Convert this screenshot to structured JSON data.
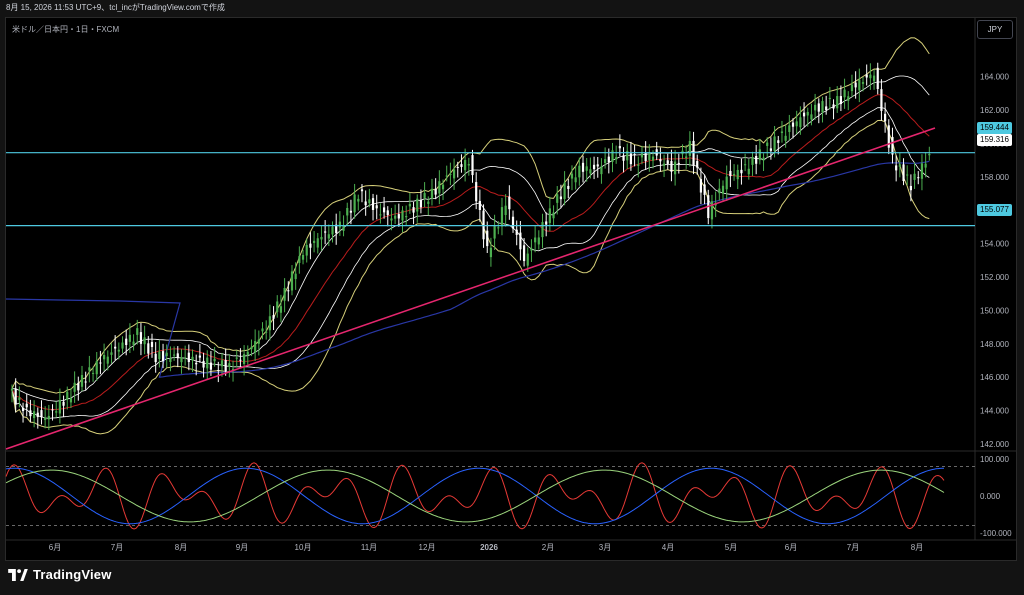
{
  "header": {
    "caption": "8月 15, 2026 11:53 UTC+9、tcl_incがTradingView.comで作成"
  },
  "symbol": {
    "label": "米ドル／日本円・1日・FXCM"
  },
  "currency_button": {
    "label": "JPY"
  },
  "brand": {
    "name": "TradingView",
    "icon": "tradingview-logo-icon"
  },
  "colors": {
    "background": "#000000",
    "candle_up": "#4caf50",
    "candle_down": "#ffffff",
    "trendline": "#e5266e",
    "horizontal_line": "#4ec9e0",
    "sma_long": "#2937a5",
    "bollinger_outer": "#d6cf7a",
    "bollinger_inner": "#ffffff",
    "bollinger_mid": "#b71c1c",
    "osc_red": "#e53935",
    "osc_blue": "#2962ff",
    "osc_green": "#9bd47d"
  },
  "price_tags": {
    "upper_level": "159.444",
    "last_price": "159.316",
    "lower_level": "155.077"
  },
  "chart_data": {
    "type": "line",
    "title": "米ドル／日本円・1日・FXCM",
    "ylim": [
      141.0,
      166.0
    ],
    "y_ticks": [
      "164.000",
      "162.000",
      "160.000",
      "158.000",
      "156.000",
      "154.000",
      "152.000",
      "150.000",
      "148.000",
      "146.000",
      "144.000",
      "142.000"
    ],
    "x_ticks": [
      "6月",
      "7月",
      "8月",
      "9月",
      "10月",
      "11月",
      "12月",
      "2026",
      "2月",
      "3月",
      "4月",
      "5月",
      "6月",
      "7月",
      "8月"
    ],
    "series": [
      {
        "type": "close",
        "values": [
          145.2,
          144.0,
          143.5,
          144.6,
          145.8,
          147.0,
          147.8,
          148.6,
          147.2,
          147.3,
          147.0,
          146.8,
          146.6,
          147.5,
          149.0,
          151.0,
          153.5,
          154.5,
          155.0,
          157.0,
          156.0,
          155.5,
          156.2,
          157.0,
          158.2,
          159.0,
          153.5,
          156.5,
          153.0,
          155.0,
          157.0,
          158.5,
          158.5,
          159.5,
          159.0,
          159.3,
          158.5,
          159.8,
          155.8,
          158.0,
          158.5,
          159.5,
          160.5,
          161.5,
          162.2,
          162.5,
          163.5,
          164.2,
          159.0,
          157.5,
          159.3
        ]
      }
    ],
    "levels": [
      159.444,
      155.077
    ],
    "oscillator": {
      "ylim": [
        -100,
        100
      ],
      "y_ticks": [
        "100.000",
        "0.000",
        "-100.000"
      ],
      "dashed_levels": [
        80,
        -80
      ]
    }
  }
}
